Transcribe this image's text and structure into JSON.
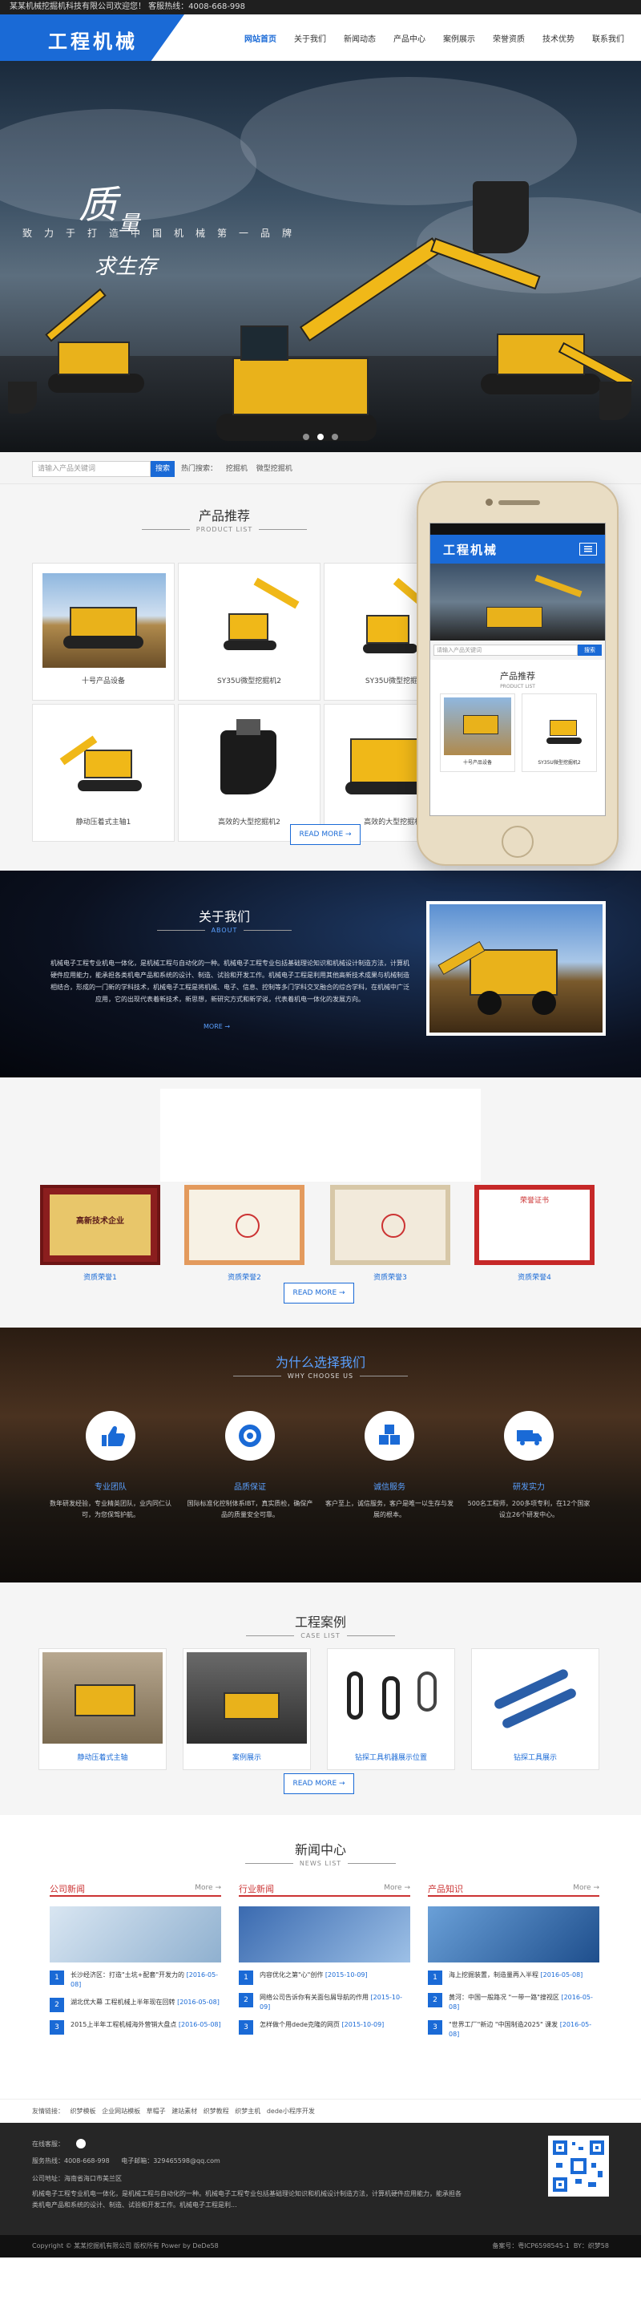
{
  "topbar": {
    "text": "某某机械挖掘机科技有限公司欢迎您！ 客服热线：4008-668-998"
  },
  "logo": {
    "text": "工程机械"
  },
  "nav": [
    "网站首页",
    "关于我们",
    "新闻动态",
    "产品中心",
    "案例展示",
    "荣誉资质",
    "技术优势",
    "联系我们"
  ],
  "hero": {
    "slogan_1": "质",
    "slogan_2": "量",
    "slogan_3": "求生存",
    "tagline": "致力于打造中国机械第一品牌"
  },
  "search": {
    "placeholder": "请输入产品关键词",
    "button": "搜索",
    "hot_label": "热门搜索：",
    "hot_items": [
      "挖掘机",
      "微型挖掘机"
    ]
  },
  "products": {
    "title": "产品推荐",
    "subtitle": "PRODUCT LIST",
    "items": [
      "十号产品设备",
      "SY35U微型挖掘机2",
      "SY35U微型挖掘机",
      "静动压着式主轴1",
      "高效的大型挖掘机2",
      "高效的大型挖掘机1"
    ],
    "more": "READ MORE →"
  },
  "phone": {
    "logo": "工程机械",
    "search_placeholder": "请输入产品关键词",
    "search_button": "搜索",
    "title": "产品推荐",
    "subtitle": "PRODUCT LIST",
    "items": [
      "十号产品设备",
      "SY35U微型挖掘机2"
    ]
  },
  "about": {
    "title": "关于我们",
    "subtitle": "ABOUT",
    "text": "机械电子工程专业机电一体化，是机械工程与自动化的一种。机械电子工程专业包括基础理论知识和机械设计制造方法，计算机硬件应用能力，能承担各类机电产品和系统的设计、制造、试验和开发工作。机械电子工程是利用其他高新技术成果与机械制造相结合，形成的一门新的学科技术，机械电子工程是将机械、电子、信息、控制等多门学科交叉融合的综合学科，在机械中广泛应用，它的出现代表着新技术，新思想，新研究方式和新学说，代表着机电一体化的发展方向。",
    "more": "MORE →"
  },
  "honors": {
    "items": [
      "资质荣誉1",
      "资质荣誉2",
      "资质荣誉3",
      "资质荣誉4"
    ],
    "cert_1_text": "高新技术企业",
    "cert_4_text": "荣誉证书",
    "more": "READ MORE →"
  },
  "why": {
    "title": "为什么选择我们",
    "subtitle": "WHY CHOOSE US",
    "items": [
      {
        "name": "专业团队",
        "desc": "数年研发经验，专业精英团队，业内同仁认可，为您保驾护航。"
      },
      {
        "name": "品质保证",
        "desc": "国际标准化控制体系IBT，真实质检，确保产品的质量安全可靠。"
      },
      {
        "name": "诚信服务",
        "desc": "客户至上，诚信服务，客户是唯一以生存与发展的根本。"
      },
      {
        "name": "研发实力",
        "desc": "500名工程师，200多项专利，在12个国家设立26个研发中心。"
      }
    ]
  },
  "cases": {
    "title": "工程案例",
    "subtitle": "CASE LIST",
    "items": [
      "静动压着式主轴",
      "案例展示",
      "钻探工具机器展示位置",
      "钻探工具展示"
    ],
    "more": "READ MORE →"
  },
  "news": {
    "title": "新闻中心",
    "subtitle": "NEWS LIST",
    "more_label": "More",
    "columns": [
      {
        "name": "公司新闻",
        "items": [
          {
            "n": "1",
            "t": "长沙经济区：打造\"土坑+配套\"开发力的",
            "d": "[2016-05-08]"
          },
          {
            "n": "2",
            "t": "湖北优大幕 工程机械上半年现在回转",
            "d": "[2016-05-08]"
          },
          {
            "n": "3",
            "t": "2015上半年工程机械海外营销大盘点",
            "d": "[2016-05-08]"
          }
        ]
      },
      {
        "name": "行业新闻",
        "items": [
          {
            "n": "1",
            "t": "内容优化之第\"心\"创作",
            "d": "[2015-10-09]"
          },
          {
            "n": "2",
            "t": "网络公司告诉你有关面包屑导航的作用",
            "d": "[2015-10-09]"
          },
          {
            "n": "3",
            "t": "怎样做个用dede克隆的网页",
            "d": "[2015-10-09]"
          }
        ]
      },
      {
        "name": "产品知识",
        "items": [
          {
            "n": "1",
            "t": "海上挖掘装置，制造量再入半程",
            "d": "[2016-05-08]"
          },
          {
            "n": "2",
            "t": "黄河：中国一般路况 \"一带一路\"搜视区",
            "d": "[2016-05-08]"
          },
          {
            "n": "3",
            "t": "\"世界工厂\"新边 \"中国制造2025\" 课发",
            "d": "[2016-05-08]"
          }
        ]
      }
    ]
  },
  "links": {
    "label": "友情链接：",
    "items": [
      "织梦模板",
      "企业网站模板",
      "草帽子",
      "建站素材",
      "织梦教程",
      "织梦主机",
      "dede小程序开发"
    ]
  },
  "footer": {
    "address_label": "在线客服：",
    "phone": "服务热线：4008-668-998",
    "email": "电子邮箱：329465598@qq.com",
    "addr2": "公司地址：海南省海口市美兰区",
    "desc": "机械电子工程专业机电一体化，是机械工程与自动化的一种。机械电子工程专业包括基础理论知识和机械设计制造方法，计算机硬件应用能力，能承担各类机电产品和系统的设计、制造、试验和开发工作。机械电子工程是利...",
    "copyright": "Copyright © 某某挖掘机有限公司 版权所有 Power by DeDe58",
    "icp": "备案号：粤ICP6598545-1",
    "by": "BY：织梦58"
  },
  "colors": {
    "brand_blue": "#1a6ad6",
    "news_red": "#c33"
  }
}
